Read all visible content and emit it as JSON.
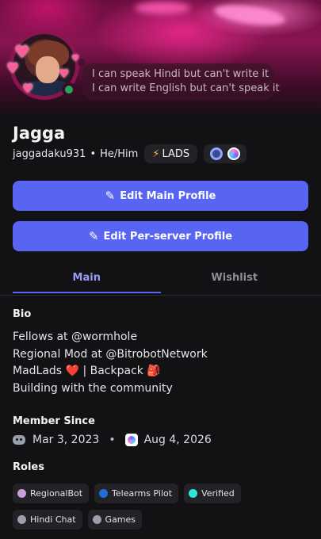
{
  "profile": {
    "display_name": "Jagga",
    "username": "jaggadaku931",
    "pronouns": "He/Him",
    "separator": "•",
    "clan_tag": "LADS",
    "clan_icon": "⚡",
    "status_line_1": "I can speak Hindi but can't write it",
    "status_line_2": "I can write English but can't speak it",
    "status_color": "#23a55a"
  },
  "buttons": {
    "edit_main": "Edit Main Profile",
    "edit_server": "Edit Per-server Profile",
    "icon": "pencil-icon"
  },
  "tabs": [
    {
      "label": "Main",
      "active": true
    },
    {
      "label": "Wishlist",
      "active": false
    }
  ],
  "bio": {
    "heading": "Bio",
    "line_1": "Fellows at @wormhole",
    "line_2": "Regional Mod at @BitrobotNetwork",
    "line_3_text": "MadLads ",
    "line_3_heart": "❤️",
    "line_3_rest": " | Backpack ",
    "line_3_bag": "🎒",
    "line_4": "Building with the community"
  },
  "member_since": {
    "heading": "Member Since",
    "discord_date": "Mar 3, 2023",
    "separator": "•",
    "server_date": "Aug 4, 2026"
  },
  "roles": {
    "heading": "Roles",
    "items": [
      {
        "name": "RegionalBot",
        "color": "#c9a0dc"
      },
      {
        "name": "Telearms Pilot",
        "color": "#1f6fd6"
      },
      {
        "name": "Verified",
        "color": "#2ee6d6"
      },
      {
        "name": "Hindi Chat",
        "color": "#9aa0ab"
      },
      {
        "name": "Games",
        "color": "#9aa0ab"
      }
    ]
  },
  "colors": {
    "accent": "#5865f2",
    "background": "#121215"
  }
}
